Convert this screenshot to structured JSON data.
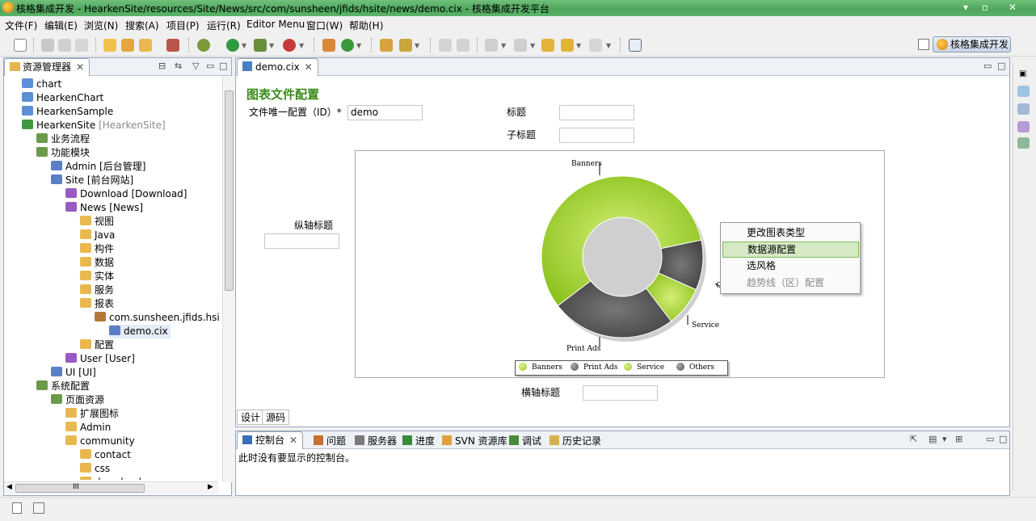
{
  "window": {
    "title": "核格集成开发 - HearkenSite/resources/Site/News/src/com/sunsheen/jfids/hsite/news/demo.cix - 核格集成开发平台",
    "min": "▾",
    "restore": "▫",
    "close": "✕"
  },
  "menu": [
    "文件(F)",
    "编辑(E)",
    "浏览(N)",
    "搜索(A)",
    "项目(P)",
    "运行(R)",
    "Editor Menu",
    "窗口(W)",
    "帮助(H)"
  ],
  "perspective": {
    "label": "核格集成开发"
  },
  "explorer": {
    "tab_label": "资源管理器",
    "tab_close": "✕",
    "items": [
      {
        "label": "chart",
        "suffix": ""
      },
      {
        "label": "HearkenChart",
        "suffix": ""
      },
      {
        "label": "HearkenSample",
        "suffix": ""
      },
      {
        "label": "HearkenSite",
        "suffix": "[HearkenSite]"
      },
      {
        "label": "业务流程",
        "suffix": ""
      },
      {
        "label": "功能模块",
        "suffix": ""
      },
      {
        "label": "Admin [后台管理]",
        "suffix": ""
      },
      {
        "label": "Site [前台网站]",
        "suffix": ""
      },
      {
        "label": "Download [Download]",
        "suffix": ""
      },
      {
        "label": "News [News]",
        "suffix": ""
      },
      {
        "label": "视图",
        "suffix": ""
      },
      {
        "label": "Java",
        "suffix": ""
      },
      {
        "label": "构件",
        "suffix": ""
      },
      {
        "label": "数据",
        "suffix": ""
      },
      {
        "label": "实体",
        "suffix": ""
      },
      {
        "label": "服务",
        "suffix": ""
      },
      {
        "label": "报表",
        "suffix": ""
      },
      {
        "label": "com.sunsheen.jfids.hsite.ne",
        "suffix": ""
      },
      {
        "label": "demo.cix",
        "suffix": ""
      },
      {
        "label": "配置",
        "suffix": ""
      },
      {
        "label": "User [User]",
        "suffix": ""
      },
      {
        "label": "UI [UI]",
        "suffix": ""
      },
      {
        "label": "系统配置",
        "suffix": ""
      },
      {
        "label": "页面资源",
        "suffix": ""
      },
      {
        "label": "扩展图标",
        "suffix": ""
      },
      {
        "label": "Admin",
        "suffix": ""
      },
      {
        "label": "community",
        "suffix": ""
      },
      {
        "label": "contact",
        "suffix": ""
      },
      {
        "label": "css",
        "suffix": ""
      },
      {
        "label": "downloads",
        "suffix": ""
      }
    ],
    "hscroll_grip": "III"
  },
  "editor": {
    "tab_label": "demo.cix",
    "tab_close": "✕",
    "heading": "图表文件配置",
    "id_label": "文件唯一配置（ID）*",
    "id_value": "demo",
    "title_label": "标题",
    "title_value": "",
    "subtitle_label": "子标题",
    "subtitle_value": "",
    "y_axis_label": "纵轴标题",
    "y_axis_value": "",
    "x_axis_label": "横轴标题",
    "x_axis_value": "",
    "bottom_tabs": [
      "设计",
      "源码"
    ]
  },
  "chart_data": {
    "type": "pie",
    "donut": true,
    "categories": [
      "Banners",
      "Print Ads",
      "Service",
      "Others"
    ],
    "values": [
      57,
      25,
      8,
      10
    ],
    "colors": [
      "#9ccb2e",
      "#555555",
      "#9ccb2e",
      "#555555"
    ],
    "legend_position": "bottom",
    "callout_labels": [
      "Banners",
      "Print Ads",
      "Service",
      "O"
    ]
  },
  "context_menu": {
    "items": [
      {
        "label": "更改图表类型",
        "state": "normal"
      },
      {
        "label": "数据源配置",
        "state": "selected"
      },
      {
        "label": "选风格",
        "state": "normal"
      },
      {
        "label": "趋势线（区）配置",
        "state": "disabled"
      }
    ]
  },
  "console": {
    "tabs": [
      {
        "label": "控制台",
        "close": "✕"
      },
      {
        "label": "问题"
      },
      {
        "label": "服务器"
      },
      {
        "label": "进度"
      },
      {
        "label": "SVN 资源库"
      },
      {
        "label": "调试"
      },
      {
        "label": "历史记录"
      }
    ],
    "message": "此时没有要显示的控制台。"
  },
  "colors": {
    "accent_green": "#3a8a1a",
    "chart_green": "#9ccb2e",
    "chart_gray": "#555555"
  }
}
